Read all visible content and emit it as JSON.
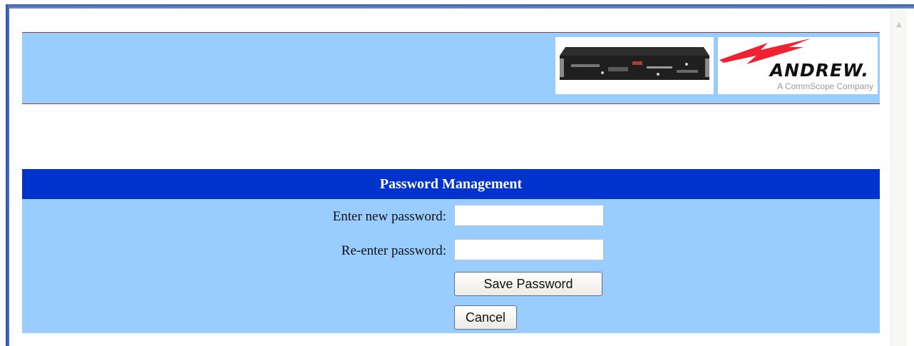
{
  "logo": {
    "brand": "ANDREW.",
    "tagline": "A CommScope Company",
    "bolt_color": "#ee2233"
  },
  "header": {
    "background_color": "#99ccff",
    "device_image_icon": "device-chassis-image"
  },
  "password_panel": {
    "title": "Password Management",
    "title_background": "#0033cc",
    "new_password_label": "Enter new password:",
    "new_password_value": "",
    "reenter_password_label": "Re-enter password:",
    "reenter_password_value": "",
    "save_label": "Save Password",
    "cancel_label": "Cancel"
  }
}
